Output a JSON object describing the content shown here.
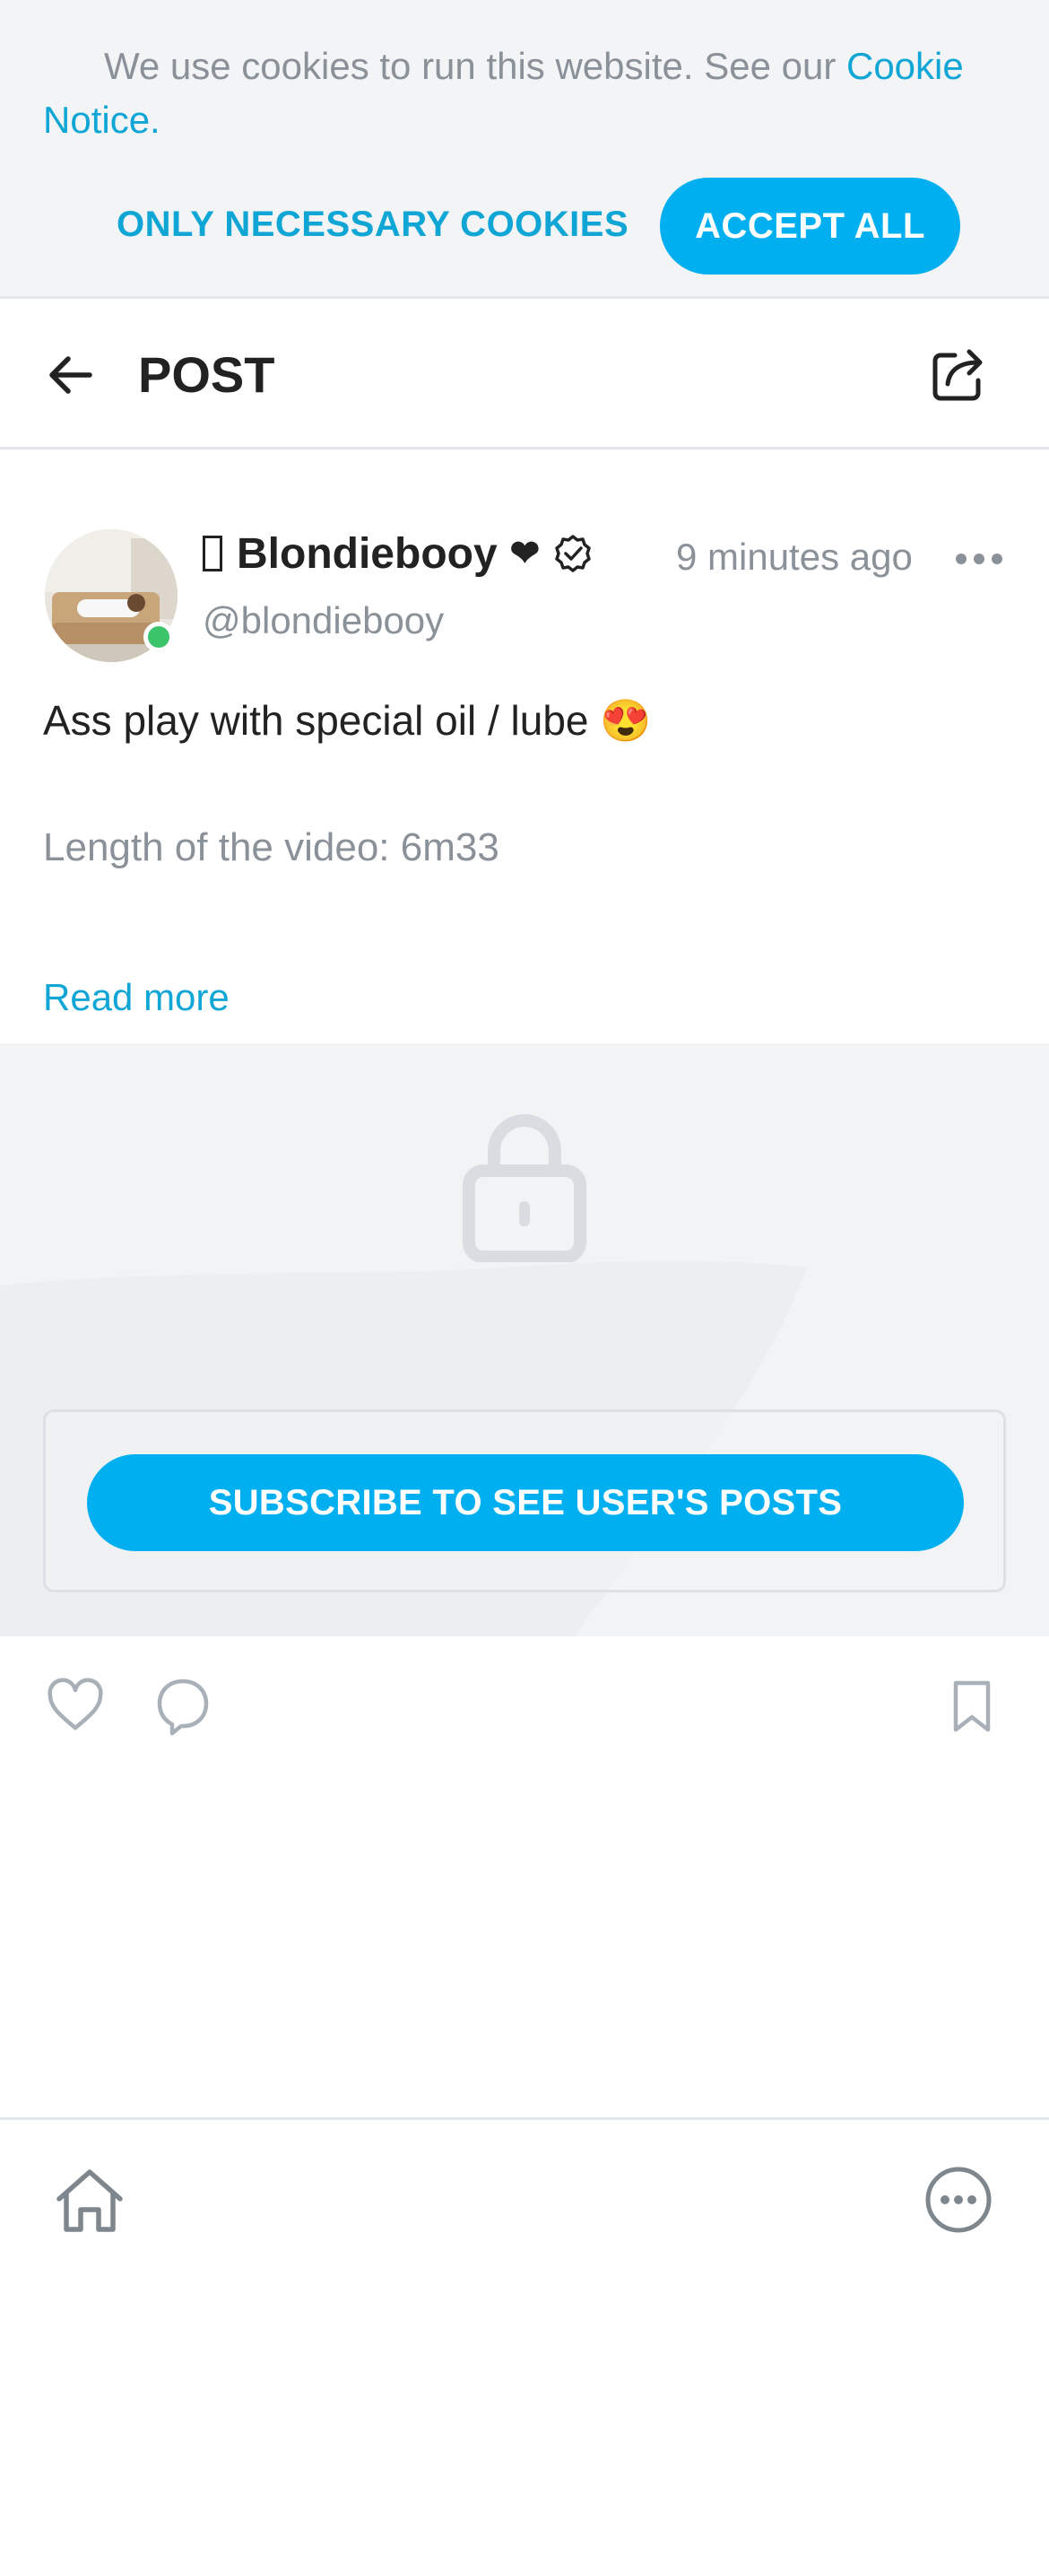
{
  "cookie_banner": {
    "text": "We use cookies to run this website. See our ",
    "link": "Cookie Notice.",
    "necessary_label": "ONLY NECESSARY COOKIES",
    "accept_label": "ACCEPT ALL"
  },
  "header": {
    "title": "POST",
    "back_icon": "arrow-left-icon",
    "share_icon": "share-icon"
  },
  "post": {
    "author_name": "Blondiebooy",
    "author_heart": "❤",
    "handle": "@blondiebooy",
    "timestamp": "9 minutes ago",
    "text": "Ass play with special oil / lube 😍",
    "subtext": "Length of the video: 6m33",
    "read_more": "Read more",
    "subscribe_label": "SUBSCRIBE TO SEE USER'S POSTS"
  },
  "colors": {
    "accent": "#00aff0",
    "link": "#0fa6d6",
    "muted": "#8a9199",
    "online": "#3cc46a"
  }
}
